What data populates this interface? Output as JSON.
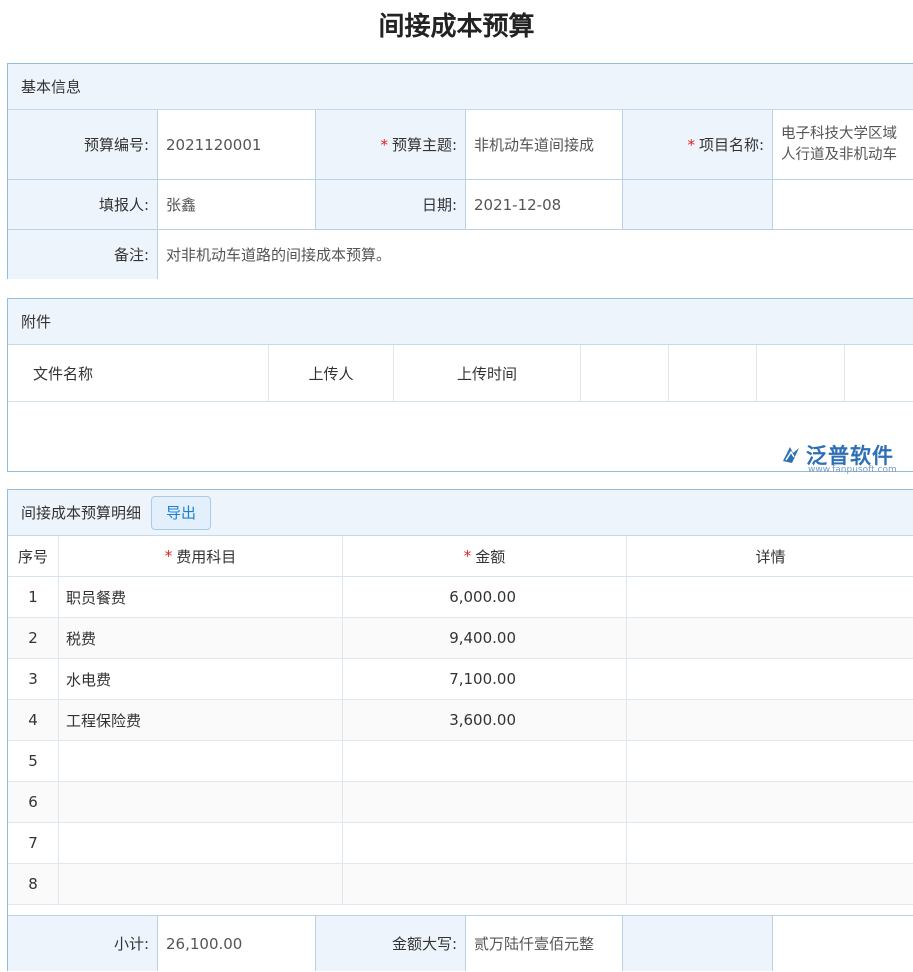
{
  "page_title": "间接成本预算",
  "basic": {
    "section_title": "基本信息",
    "budget_no_label": "预算编号:",
    "budget_no_value": "2021120001",
    "subject_label": "预算主题:",
    "subject_value": "非机动车道间接成",
    "project_label": "项目名称:",
    "project_value_line1": "电子科技大学区域",
    "project_value_line2": "人行道及非机动车",
    "reporter_label": "填报人:",
    "reporter_value": "张鑫",
    "date_label": "日期:",
    "date_value": "2021-12-08",
    "remark_label": "备注:",
    "remark_value": "对非机动车道路的间接成本预算。",
    "required_mark": "*"
  },
  "attachments": {
    "section_title": "附件",
    "columns": [
      "文件名称",
      "上传人",
      "上传时间"
    ]
  },
  "detail": {
    "section_title": "间接成本预算明细",
    "export_label": "导出",
    "columns": {
      "no": "序号",
      "item": "费用科目",
      "amount": "金额",
      "detail": "详情"
    },
    "rows": [
      {
        "no": "1",
        "item": "职员餐费",
        "amount": "6,000.00",
        "detail": ""
      },
      {
        "no": "2",
        "item": "税费",
        "amount": "9,400.00",
        "detail": ""
      },
      {
        "no": "3",
        "item": "水电费",
        "amount": "7,100.00",
        "detail": ""
      },
      {
        "no": "4",
        "item": "工程保险费",
        "amount": "3,600.00",
        "detail": ""
      },
      {
        "no": "5",
        "item": "",
        "amount": "",
        "detail": ""
      },
      {
        "no": "6",
        "item": "",
        "amount": "",
        "detail": ""
      },
      {
        "no": "7",
        "item": "",
        "amount": "",
        "detail": ""
      },
      {
        "no": "8",
        "item": "",
        "amount": "",
        "detail": ""
      }
    ],
    "subtotal_label": "小计:",
    "subtotal_value": "26,100.00",
    "capital_label": "金额大写:",
    "capital_value": "贰万陆仟壹佰元整"
  },
  "logo": {
    "name": "泛普软件",
    "site": "www.fanpusoft.com"
  },
  "colors": {
    "accent": "#1e7fd0",
    "panel_border": "#93bddc",
    "label_bg": "#eef4fb",
    "required": "#e02020"
  }
}
